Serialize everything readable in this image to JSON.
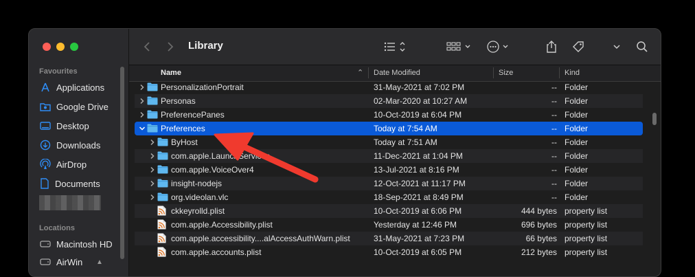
{
  "window": {
    "title": "Library"
  },
  "sidebar": {
    "favourites_label": "Favourites",
    "items": [
      {
        "label": "Applications",
        "icon": "applications-icon"
      },
      {
        "label": "Google Drive",
        "icon": "drive-folder-icon"
      },
      {
        "label": "Desktop",
        "icon": "desktop-icon"
      },
      {
        "label": "Downloads",
        "icon": "downloads-icon"
      },
      {
        "label": "AirDrop",
        "icon": "airdrop-icon"
      },
      {
        "label": "Documents",
        "icon": "documents-icon"
      }
    ],
    "locations_label": "Locations",
    "locations": [
      {
        "label": "Macintosh HD",
        "icon": "disk-icon"
      },
      {
        "label": "AirWin",
        "icon": "disk-icon"
      }
    ]
  },
  "columns": {
    "name": "Name",
    "date": "Date Modified",
    "size": "Size",
    "kind": "Kind"
  },
  "files": [
    {
      "name": "PersonalizationPortrait",
      "date": "31-May-2021 at 7:02 PM",
      "size": "--",
      "kind": "Folder",
      "type": "folder",
      "level": 0,
      "expandable": true
    },
    {
      "name": "Personas",
      "date": "02-Mar-2020 at 10:27 AM",
      "size": "--",
      "kind": "Folder",
      "type": "folder",
      "level": 0,
      "expandable": true
    },
    {
      "name": "PreferencePanes",
      "date": "10-Oct-2019 at 6:04 PM",
      "size": "--",
      "kind": "Folder",
      "type": "folder",
      "level": 0,
      "expandable": true
    },
    {
      "name": "Preferences",
      "date": "Today at 7:54 AM",
      "size": "--",
      "kind": "Folder",
      "type": "folder",
      "level": 0,
      "expandable": true,
      "expanded": true,
      "selected": true
    },
    {
      "name": "ByHost",
      "date": "Today at 7:51 AM",
      "size": "--",
      "kind": "Folder",
      "type": "folder",
      "level": 1,
      "expandable": true
    },
    {
      "name": "com.apple.LaunchServices",
      "date": "11-Dec-2021 at 1:04 PM",
      "size": "--",
      "kind": "Folder",
      "type": "folder",
      "level": 1,
      "expandable": true
    },
    {
      "name": "com.apple.VoiceOver4",
      "date": "13-Jul-2021 at 8:16 PM",
      "size": "--",
      "kind": "Folder",
      "type": "folder",
      "level": 1,
      "expandable": true
    },
    {
      "name": "insight-nodejs",
      "date": "12-Oct-2021 at 11:17 PM",
      "size": "--",
      "kind": "Folder",
      "type": "folder",
      "level": 1,
      "expandable": true
    },
    {
      "name": "org.videolan.vlc",
      "date": "18-Sep-2021 at 8:49 PM",
      "size": "--",
      "kind": "Folder",
      "type": "folder",
      "level": 1,
      "expandable": true
    },
    {
      "name": "ckkeyrolld.plist",
      "date": "10-Oct-2019 at 6:06 PM",
      "size": "444 bytes",
      "kind": "property list",
      "type": "plist",
      "level": 1
    },
    {
      "name": "com.apple.Accessibility.plist",
      "date": "Yesterday at 12:46 PM",
      "size": "696 bytes",
      "kind": "property list",
      "type": "plist",
      "level": 1
    },
    {
      "name": "com.apple.accessibility....alAccessAuthWarn.plist",
      "date": "31-May-2021 at 7:23 PM",
      "size": "66 bytes",
      "kind": "property list",
      "type": "plist",
      "level": 1
    },
    {
      "name": "com.apple.accounts.plist",
      "date": "10-Oct-2019 at 6:05 PM",
      "size": "212 bytes",
      "kind": "property list",
      "type": "plist",
      "level": 1
    }
  ],
  "colors": {
    "accent": "#0a5ad8",
    "arrow": "#f03a2e",
    "folder": "#5fb8f0"
  }
}
